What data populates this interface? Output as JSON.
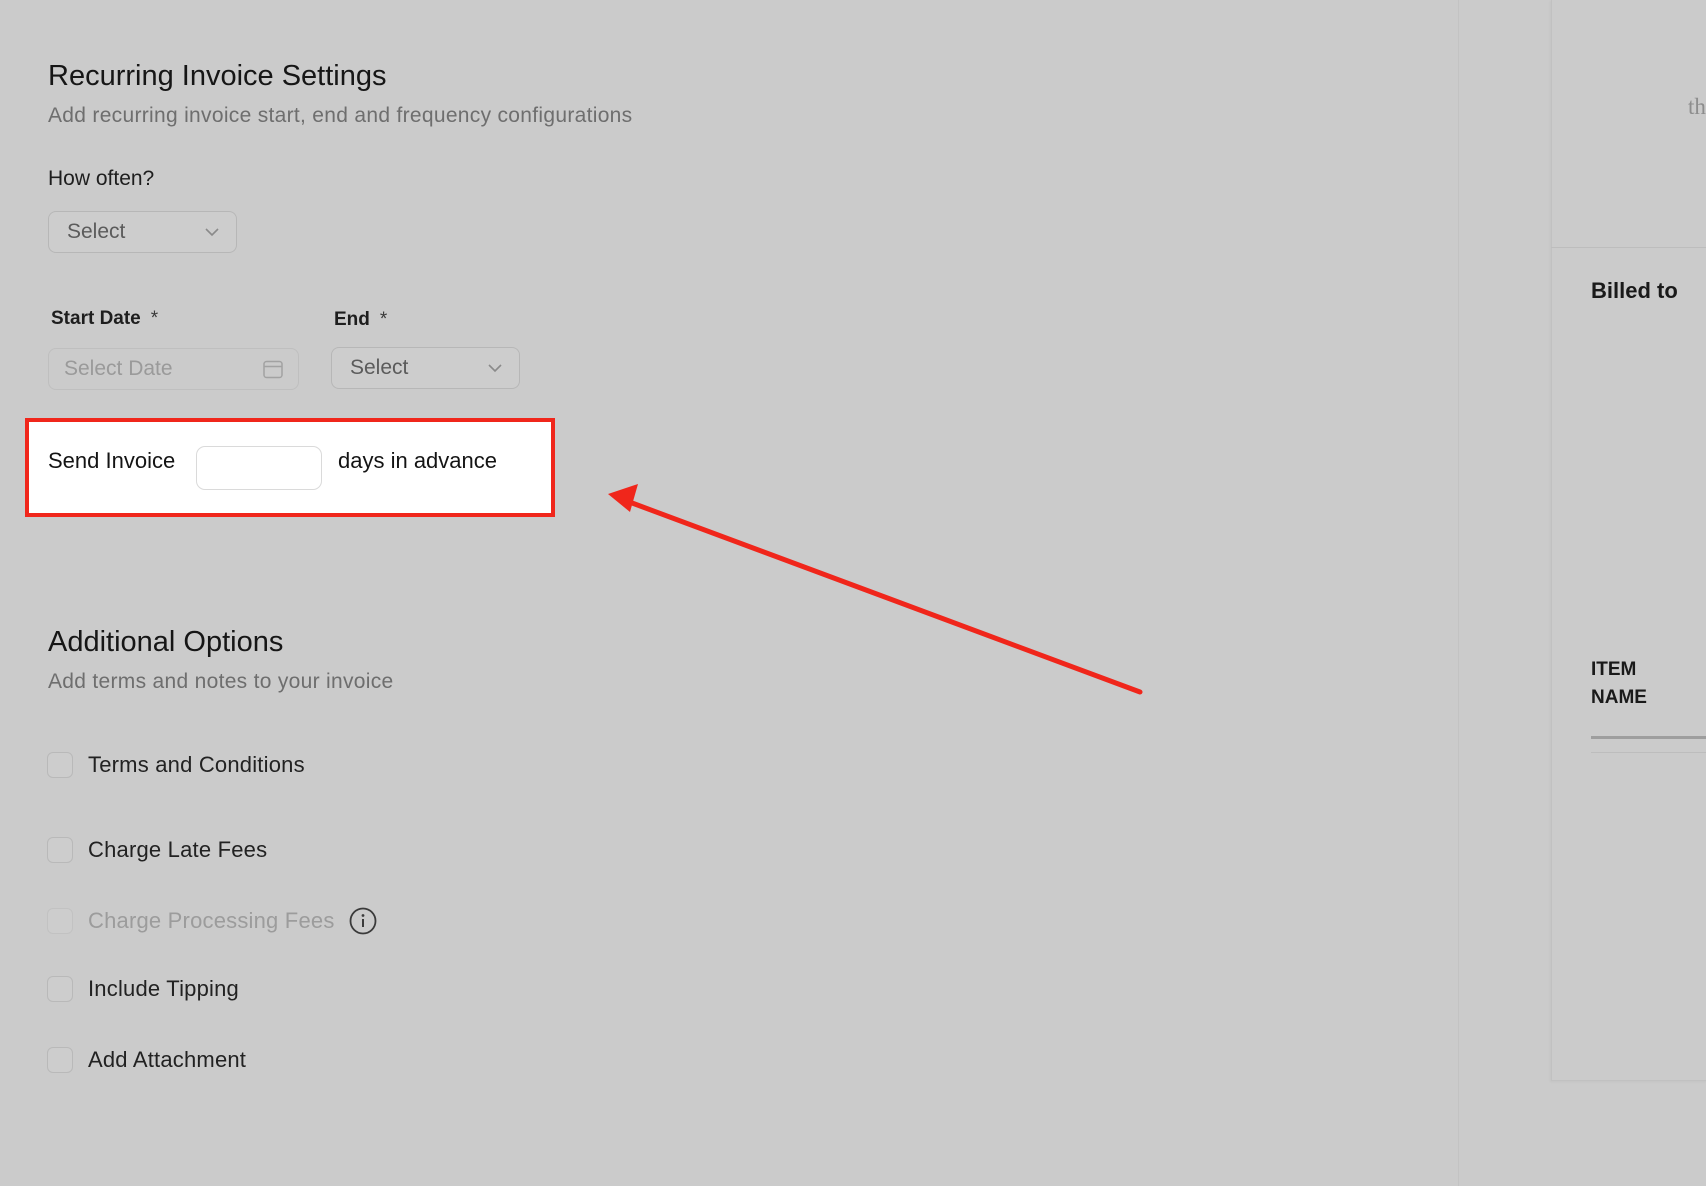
{
  "recurring": {
    "title": "Recurring Invoice Settings",
    "subtitle": "Add recurring invoice start, end and frequency configurations",
    "how_often_label": "How often?",
    "how_often_value": "Select",
    "start_date_label": "Start Date",
    "start_date_placeholder": "Select Date",
    "end_label": "End",
    "end_value": "Select",
    "required_mark": "*"
  },
  "send_invoice": {
    "prefix": "Send Invoice",
    "value": "",
    "suffix": "days in advance"
  },
  "additional": {
    "title": "Additional Options",
    "subtitle": "Add terms and notes to your invoice",
    "options": [
      {
        "label": "Terms and Conditions",
        "checked": false,
        "disabled": false
      },
      {
        "label": "Charge Late Fees",
        "checked": false,
        "disabled": false
      },
      {
        "label": "Charge Processing Fees",
        "checked": false,
        "disabled": true
      },
      {
        "label": "Include Tipping",
        "checked": false,
        "disabled": false
      },
      {
        "label": "Add Attachment",
        "checked": false,
        "disabled": false
      }
    ]
  },
  "preview": {
    "cutoff_text": "th",
    "billed_to": "Billed to",
    "item_name": "ITEM NAME"
  },
  "colors": {
    "highlight_border": "#f0261b",
    "arrow": "#f0261b",
    "background": "#cbcbcb"
  }
}
